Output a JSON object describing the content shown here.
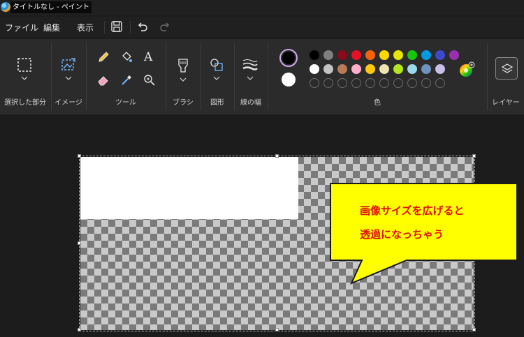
{
  "window": {
    "title": "タイトルなし - ペイント"
  },
  "menu": {
    "file": "ファイル",
    "edit": "編集",
    "view": "表示"
  },
  "groups": {
    "selection": "選択した部分",
    "image": "イメージ",
    "tools": "ツール",
    "brushes": "ブラシ",
    "shapes": "図形",
    "line_width": "線の幅",
    "colors": "色",
    "layers": "レイヤー"
  },
  "tools": {
    "text_glyph": "A"
  },
  "colors": {
    "primary": "#000000",
    "secondary": "#ffffff",
    "row1": [
      "#000000",
      "#7f7f7f",
      "#8b0a1a",
      "#e81123",
      "#f7630c",
      "#ffd800",
      "#e6e600",
      "#16c60c",
      "#0099e6",
      "#3e48cc",
      "#9b2fae"
    ],
    "row2": [
      "#ffffff",
      "#c3c3c3",
      "#b97a57",
      "#ffaec9",
      "#ffc90e",
      "#efe4b0",
      "#b5e61d",
      "#99d9ea",
      "#7092be",
      "#c8bfe7"
    ],
    "row3_empty_count": 10
  },
  "callout": {
    "line1": "画像サイズを広げると",
    "line2": "透過になっちゃう",
    "fill": "#ffff00",
    "text_color": "#e0100a"
  }
}
